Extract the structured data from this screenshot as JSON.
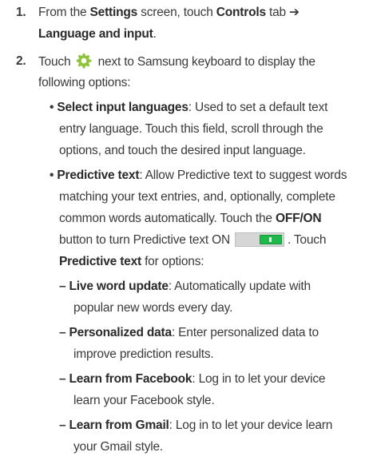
{
  "steps": [
    {
      "number": "1.",
      "line1": {
        "pre": "From the ",
        "b1": "Settings",
        "mid": " screen, touch ",
        "b2": "Controls",
        "post": " tab ➔"
      },
      "line2": {
        "b1": "Language and input",
        "post": "."
      }
    },
    {
      "number": "2.",
      "line1": {
        "pre": "Touch",
        "post": "next to Samsung keyboard to display the",
        "icon": "gear-icon"
      },
      "line2": "following options:"
    }
  ],
  "options": [
    {
      "bullet": "•",
      "title": "Select input languages",
      "line1_rest": ": Used to set a default text",
      "line2": "entry language. Touch this field, scroll through the",
      "line3": "options, and touch the desired input language."
    },
    {
      "bullet": "•",
      "title": "Predictive text",
      "line1_rest": ": Allow Predictive text to suggest words",
      "line2": "matching your text entries, and, optionally, complete",
      "line3_pre": "common words automatically. Touch the ",
      "line3_bold": "OFF/ON",
      "line4_pre": "button to turn Predictive text ON",
      "line4_post": ". Touch",
      "toggle_state": "ON",
      "toggle_color": "#1fb84a",
      "line5_bold": "Predictive text",
      "line5_post": " for options:"
    }
  ],
  "suboptions": [
    {
      "dash": "–",
      "title": "Live word update",
      "rest": ": Automatically update with",
      "line2": "popular new words every day."
    },
    {
      "dash": "–",
      "title": "Personalized data",
      "rest": ": Enter personalized data to",
      "line2": "improve prediction results."
    },
    {
      "dash": "–",
      "title": "Learn from Facebook",
      "rest": ": Log in to let your device",
      "line2": "learn your Facebook style."
    },
    {
      "dash": "–",
      "title": "Learn from Gmail",
      "rest": ": Log in to let your device learn",
      "line2": "your Gmail style."
    }
  ]
}
